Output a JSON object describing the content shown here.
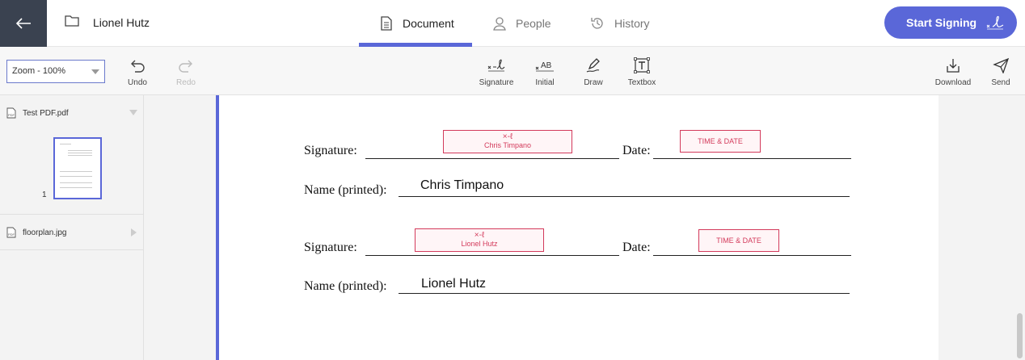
{
  "header": {
    "title": "Lionel Hutz",
    "tabs": [
      {
        "label": "Document",
        "active": true
      },
      {
        "label": "People",
        "active": false
      },
      {
        "label": "History",
        "active": false
      }
    ],
    "start_signing_label": "Start Signing",
    "accent": "#5a67d8"
  },
  "toolbar": {
    "zoom_value": "Zoom - 100%",
    "undo_label": "Undo",
    "redo_label": "Redo",
    "signature_label": "Signature",
    "initial_label": "Initial",
    "draw_label": "Draw",
    "textbox_label": "Textbox",
    "download_label": "Download",
    "send_label": "Send"
  },
  "sidebar": {
    "files": [
      {
        "name": "Test PDF.pdf",
        "expanded": true,
        "pages": [
          "1"
        ]
      },
      {
        "name": "floorplan.jpg",
        "expanded": false
      }
    ]
  },
  "document": {
    "signature_label": "Signature:",
    "date_label": "Date:",
    "name_label": "Name (printed):",
    "field_color": "#d33a5b",
    "signers": [
      {
        "signature_field": "Chris Timpano",
        "date_field": "TIME & DATE",
        "printed_name": "Chris Timpano"
      },
      {
        "signature_field": "Lionel Hutz",
        "date_field": "TIME & DATE",
        "printed_name": "Lionel Hutz"
      }
    ]
  }
}
